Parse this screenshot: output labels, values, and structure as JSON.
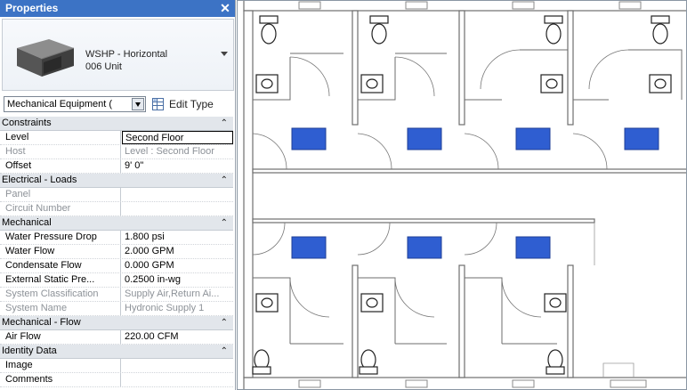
{
  "palette": {
    "title": "Properties",
    "close_icon": "close-icon",
    "type_name_line1": "WSHP - Horizontal",
    "type_name_line2": "006 Unit",
    "filter_value": "Mechanical Equipment (",
    "edit_type_label": "Edit Type"
  },
  "groups": {
    "constraints": "Constraints",
    "electrical": "Electrical - Loads",
    "mechanical": "Mechanical",
    "mech_flow": "Mechanical - Flow",
    "identity": "Identity Data"
  },
  "rows": {
    "level": {
      "k": "Level",
      "v": "Second Floor"
    },
    "host": {
      "k": "Host",
      "v": "Level : Second Floor"
    },
    "offset": {
      "k": "Offset",
      "v": "9'  0\""
    },
    "panel": {
      "k": "Panel",
      "v": ""
    },
    "circuit": {
      "k": "Circuit Number",
      "v": ""
    },
    "wpd": {
      "k": "Water Pressure Drop",
      "v": "1.800 psi"
    },
    "wflow": {
      "k": "Water Flow",
      "v": "2.000 GPM"
    },
    "cflow": {
      "k": "Condensate Flow",
      "v": "0.000 GPM"
    },
    "esp": {
      "k": "External Static Pre...",
      "v": "0.2500 in-wg"
    },
    "sysclass": {
      "k": "System Classification",
      "v": "Supply Air,Return Ai..."
    },
    "sysname": {
      "k": "System Name",
      "v": "Hydronic Supply 1"
    },
    "airflow": {
      "k": "Air Flow",
      "v": "220.00 CFM"
    },
    "image": {
      "k": "Image",
      "v": ""
    },
    "comments": {
      "k": "Comments",
      "v": ""
    }
  },
  "colors": {
    "title_bar": "#3c73c5",
    "group_bg": "#e2e6eb",
    "selected_unit": "#2f5ed1",
    "wall": "#6e6e6e"
  },
  "icons": [
    "close-icon",
    "chevron-up-icon",
    "dropdown-arrow-icon",
    "edit-type-icon",
    "equipment-thumbnail-icon"
  ]
}
